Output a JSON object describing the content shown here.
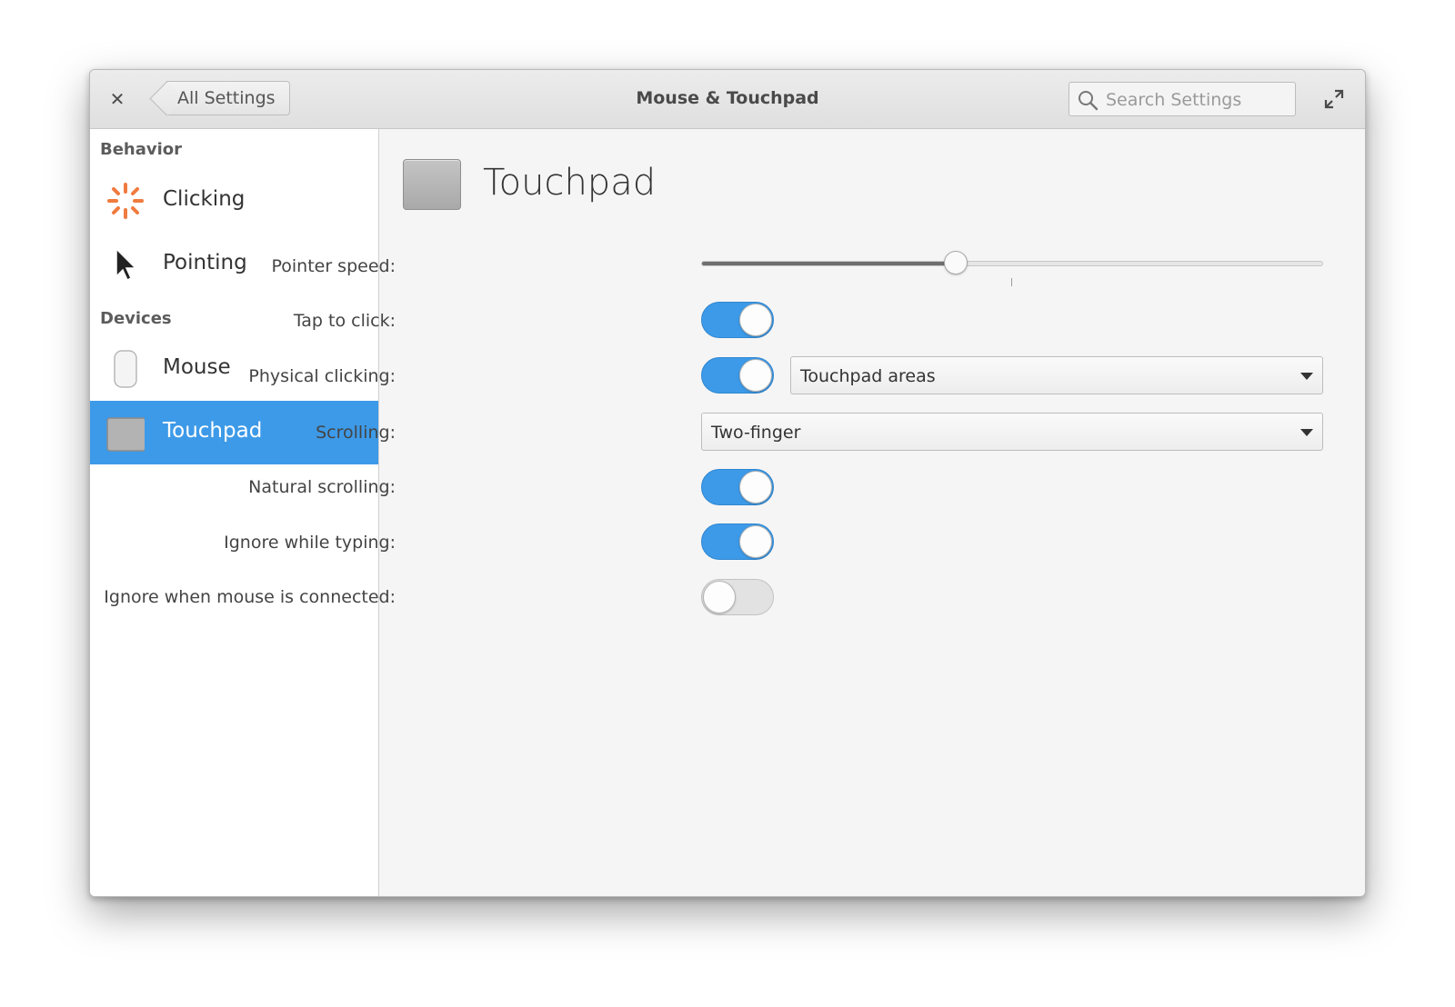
{
  "window": {
    "title": "Mouse & Touchpad",
    "back_label": "All Settings",
    "search_placeholder": "Search Settings"
  },
  "sidebar": {
    "sections": [
      {
        "title": "Behavior",
        "items": [
          {
            "label": "Clicking",
            "icon": "clicking-icon"
          },
          {
            "label": "Pointing",
            "icon": "pointer-icon"
          }
        ]
      },
      {
        "title": "Devices",
        "items": [
          {
            "label": "Mouse",
            "icon": "mouse-icon"
          },
          {
            "label": "Touchpad",
            "icon": "touchpad-icon",
            "selected": true
          }
        ]
      }
    ]
  },
  "content": {
    "heading": "Touchpad",
    "pointer_speed": {
      "label": "Pointer speed:",
      "value": 0.41
    },
    "tap_to_click": {
      "label": "Tap to click:",
      "on": true
    },
    "physical_clicking": {
      "label": "Physical clicking:",
      "on": true,
      "option": "Touchpad areas"
    },
    "scrolling": {
      "label": "Scrolling:",
      "option": "Two-finger"
    },
    "natural_scrolling": {
      "label": "Natural scrolling:",
      "on": true
    },
    "ignore_while_typing": {
      "label": "Ignore while typing:",
      "on": true
    },
    "ignore_mouse": {
      "label": "Ignore when mouse is connected:",
      "on": false
    }
  },
  "colors": {
    "accent": "#3d9ae8",
    "clicking_icon": "#f07b3f"
  }
}
